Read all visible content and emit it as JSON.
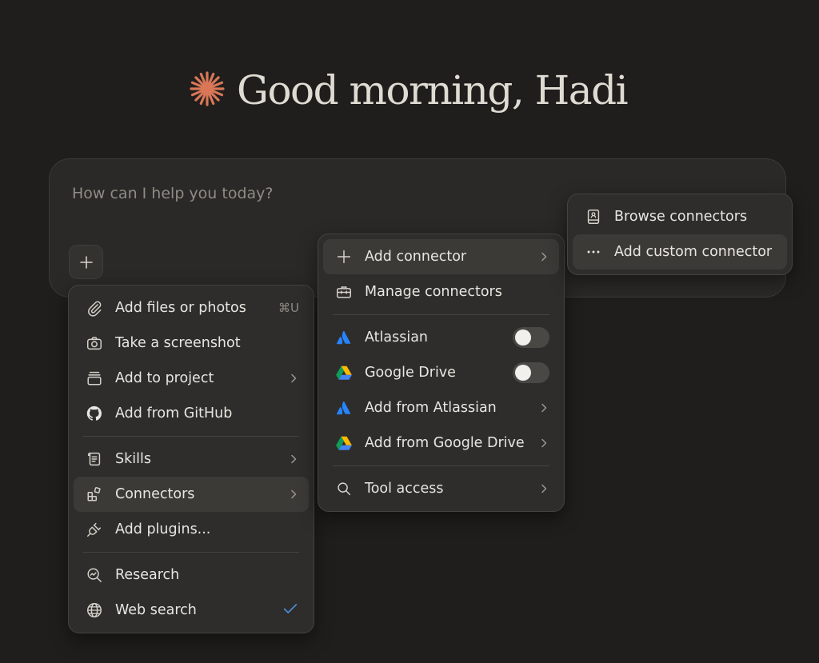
{
  "greeting": {
    "text": "Good morning, Hadi",
    "accent_color": "#d97757"
  },
  "composer": {
    "placeholder": "How can I help you today?",
    "add_icon": "plus-icon"
  },
  "main_menu": {
    "items": [
      {
        "label": "Add files or photos",
        "icon": "paperclip-icon",
        "shortcut": "⌘U"
      },
      {
        "label": "Take a screenshot",
        "icon": "camera-icon"
      },
      {
        "label": "Add to project",
        "icon": "project-icon"
      },
      {
        "label": "Add from GitHub",
        "icon": "github-icon"
      },
      {
        "label": "Skills",
        "icon": "scroll-icon"
      },
      {
        "label": "Connectors",
        "icon": "connectors-icon"
      },
      {
        "label": "Add plugins...",
        "icon": "plug-icon"
      },
      {
        "label": "Research",
        "icon": "research-icon"
      },
      {
        "label": "Web search",
        "icon": "globe-icon",
        "checked": true
      }
    ],
    "check_color": "#4f8fe0"
  },
  "connectors_menu": {
    "items": [
      {
        "label": "Add connector",
        "icon": "plus-icon"
      },
      {
        "label": "Manage connectors",
        "icon": "toolbox-icon"
      },
      {
        "label": "Atlassian",
        "icon": "atlassian-icon",
        "enabled": false
      },
      {
        "label": "Google Drive",
        "icon": "google-drive-icon",
        "enabled": false
      },
      {
        "label": "Add from Atlassian",
        "icon": "atlassian-icon"
      },
      {
        "label": "Add from Google Drive",
        "icon": "google-drive-icon"
      },
      {
        "label": "Tool access",
        "icon": "search-icon"
      }
    ]
  },
  "add_connector_menu": {
    "items": [
      {
        "label": "Browse connectors",
        "icon": "book-icon"
      },
      {
        "label": "Add custom connector",
        "icon": "more-icon"
      }
    ]
  }
}
